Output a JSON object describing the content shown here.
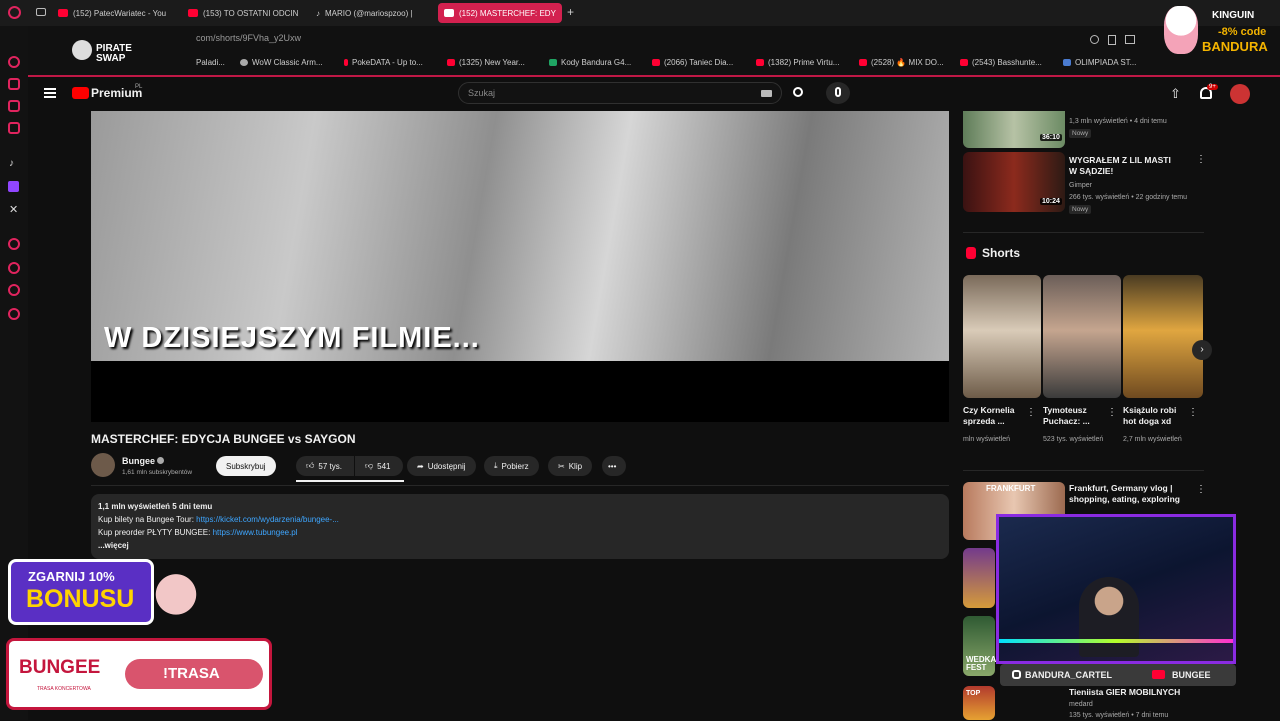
{
  "browser": {
    "tabs": [
      {
        "label": "(152) PatecWariatec - You"
      },
      {
        "label": "(153) TO OSTATNI ODCIN"
      },
      {
        "label": "MARIO (@mariospzoo) |"
      },
      {
        "label": "(152) MASTERCHEF: EDY"
      }
    ],
    "url": "com/shorts/9FVha_y2Uxw",
    "bookmarks": [
      "Paladi...",
      "WoW Classic Arm...",
      "PokeDATA - Up to...",
      "(1325) New Year...",
      "Kody Bandura G4...",
      "(2066) Taniec Dia...",
      "(1382) Prime Virtu...",
      "(2528) 🔥 MIX DO...",
      "(2543) Basshunte...",
      "OLIMPIADA ST..."
    ],
    "ext_logo": "PIRATE SWAP"
  },
  "youtube": {
    "logo": "Premium",
    "logo_sup": "PL",
    "search_placeholder": "Szukaj",
    "notif_badge": "9+"
  },
  "video": {
    "overlay_text": "W DZISIEJSZYM FILMIE...",
    "title": "MASTERCHEF: EDYCJA BUNGEE vs SAYGON",
    "channel": "Bungee",
    "subscribers": "1,61 mln subskrybentów",
    "subscribe_label": "Subskrybuj",
    "likes": "57 tys.",
    "dislikes": "541",
    "share": "Udostępnij",
    "download": "Pobierz",
    "clip": "Klip",
    "description": {
      "stats": "1,1 mln wyświetleń  5 dni temu",
      "line1_prefix": "Kup bilety na Bungee Tour:",
      "line1_link": "https://kicket.com/wydarzenia/bungee-...",
      "line2_prefix": "Kup preorder PŁYTY BUNGEE:",
      "line2_link": "https://www.tubungee.pl",
      "more": "...więcej"
    }
  },
  "sidebar_videos": [
    {
      "meta1": "1,3 mln wyświetleń • 4 dni temu",
      "badge": "Nowy",
      "duration": "36:10"
    },
    {
      "title": "WYGRAŁEM Z LIL MASTI W SĄDZIE!",
      "channel": "Gimper",
      "meta": "266 tys. wyświetleń • 22 godziny temu",
      "badge": "Nowy",
      "duration": "10:24"
    }
  ],
  "shorts": {
    "heading": "Shorts",
    "items": [
      {
        "title": "Czy Kornelia sprzeda ...",
        "views": "mln wyświetleń"
      },
      {
        "title": "Tymoteusz Puchacz: ...",
        "views": "523 tys. wyświetleń"
      },
      {
        "title": "Książulo robi hot doga xd",
        "views": "2,7 mln wyświetleń"
      }
    ]
  },
  "more_videos": [
    {
      "title": "Frankfurt, Germany vlog | shopping, eating, exploring",
      "thumb_text": "FRANKFURT"
    },
    {
      "title": "Tieniista GIER MOBILNYCH",
      "channel": "medard",
      "meta": "135 tys. wyświetleń • 7 dni temu",
      "thumb_text": "TOP"
    },
    {
      "thumb_text": "WEDKARSKI FEST"
    }
  ],
  "overlays": {
    "bonus_line1": "ZGARNIJ 10%",
    "bonus_line2": "BONUSU",
    "bungee_logo": "BUNGEE",
    "bungee_sub": "TRASA KONCERTOWA",
    "trasa": "!TRASA",
    "social_left": "BANDURA_CARTEL",
    "social_right": "BUNGEE",
    "kinguin_brand": "KINGUIN",
    "kinguin_promo": "-8% code",
    "kinguin_code": "BANDURA"
  }
}
